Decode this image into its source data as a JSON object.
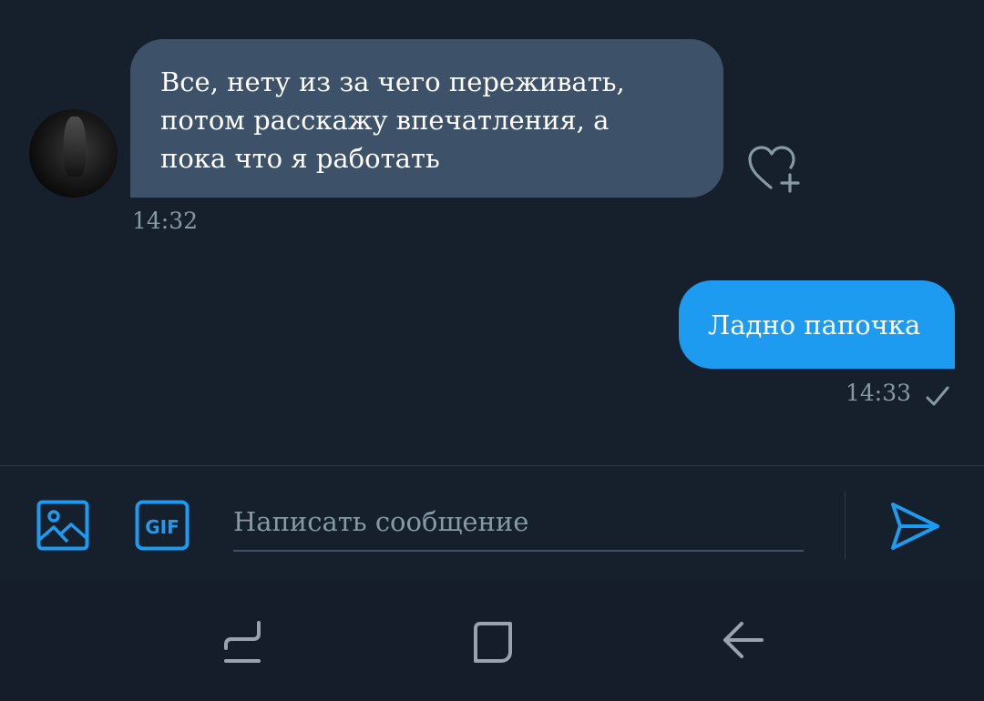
{
  "messages": [
    {
      "direction": "incoming",
      "text": "Все, нету из за чего переживать,\nпотом расскажу впечатления, а\nпока что я работать",
      "time": "14:32",
      "reaction_icon": "heart-plus-icon"
    },
    {
      "direction": "outgoing",
      "text": "Ладно папочка",
      "time": "14:33",
      "status_icon": "check-icon"
    }
  ],
  "composer": {
    "placeholder": "Написать сообщение",
    "media_icon": "image-icon",
    "gif_label": "GIF",
    "send_icon": "send-icon"
  },
  "navbar": {
    "icons": [
      "recent-apps-icon",
      "home-icon",
      "back-icon"
    ]
  },
  "colors": {
    "background": "#16202d",
    "incoming_bubble": "#3d5268",
    "outgoing_bubble": "#1d9bf0",
    "accent": "#1d9bf0",
    "secondary_text": "#8899a6"
  }
}
